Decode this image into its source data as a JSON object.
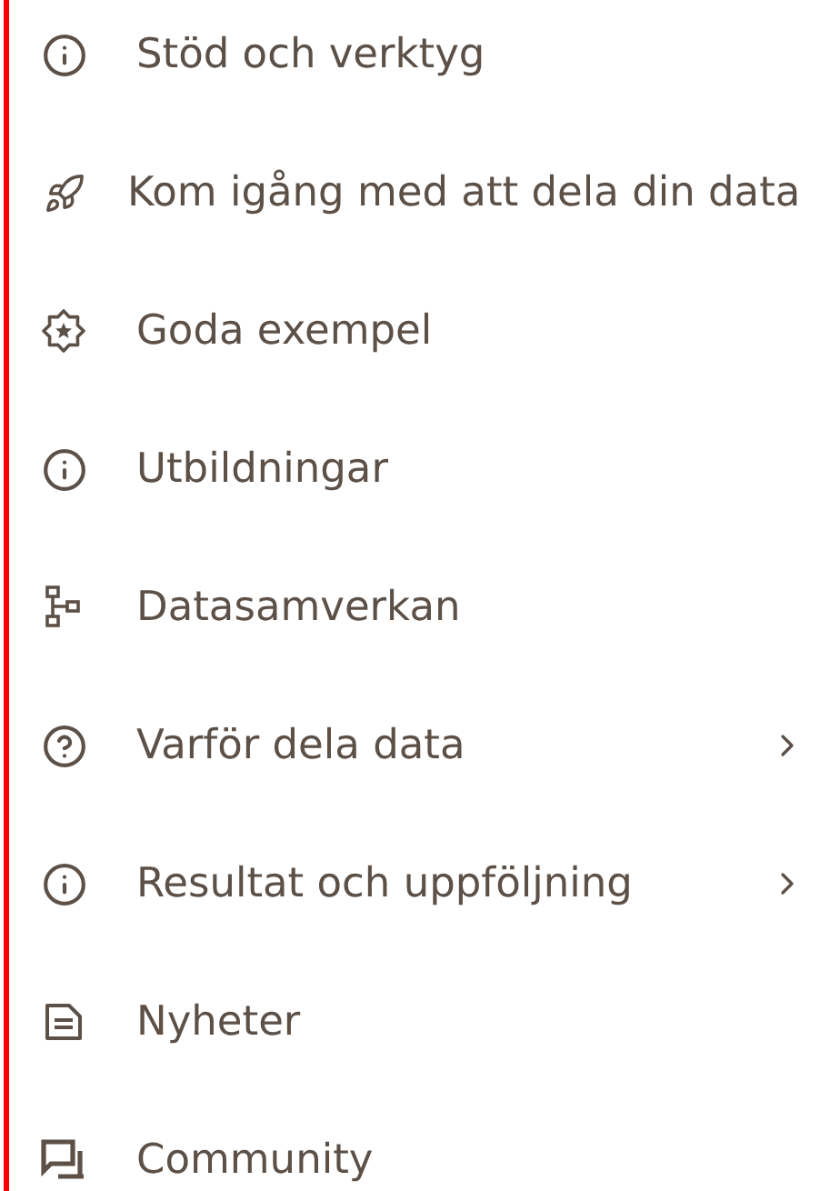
{
  "menu": {
    "items": [
      {
        "label": "Stöd och verktyg",
        "kind": "info",
        "submenu": false
      },
      {
        "label": "Kom igång med att dela din data",
        "kind": "rocket",
        "submenu": false
      },
      {
        "label": "Goda exempel",
        "kind": "badge",
        "submenu": false
      },
      {
        "label": "Utbildningar",
        "kind": "info",
        "submenu": false
      },
      {
        "label": "Datasamverkan",
        "kind": "hierarchy",
        "submenu": false
      },
      {
        "label": "Varför dela data",
        "kind": "question",
        "submenu": true
      },
      {
        "label": "Resultat och uppföljning",
        "kind": "info",
        "submenu": true
      },
      {
        "label": "Nyheter",
        "kind": "document",
        "submenu": false
      },
      {
        "label": "Community",
        "kind": "chat",
        "submenu": false
      }
    ]
  }
}
